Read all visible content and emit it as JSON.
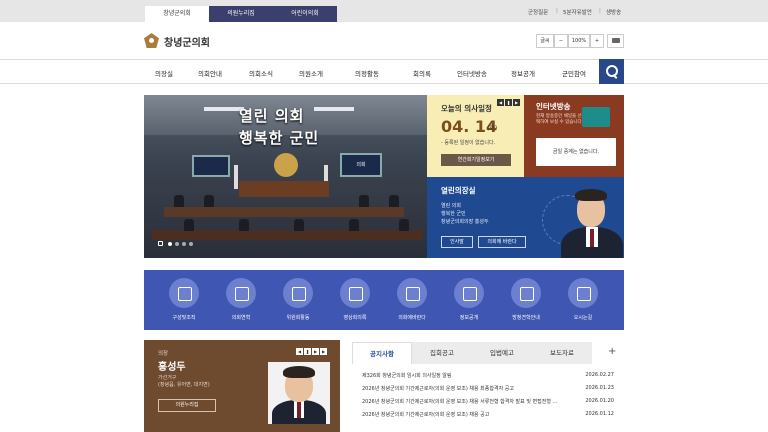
{
  "topbar": {
    "tabs": [
      "창녕군의회",
      "의원누리집",
      "어린이의회"
    ],
    "links": [
      "군정질문",
      "5분자유발언",
      "생방송"
    ]
  },
  "header": {
    "logo_text": "창녕군의회",
    "zoom": {
      "label": "글씨",
      "minus": "−",
      "value": "100%",
      "plus": "+"
    }
  },
  "nav": {
    "items": [
      "의장실",
      "의회안내",
      "의회소식",
      "의원소개",
      "의정활동",
      "회의록",
      "인터넷방송",
      "정보공개",
      "군민참여"
    ]
  },
  "hero": {
    "line1": "열린 의회",
    "line2": "행복한 군민",
    "screen_label": "의회"
  },
  "schedule": {
    "title": "오늘의 의사일정",
    "date": "04. 14",
    "day": "(화)",
    "note": "- 등록된 일정이 없습니다.",
    "button": "연간회기일정보기"
  },
  "broadcast": {
    "title": "인터넷방송",
    "desc": "현재 방송중인 채널을 선택하여 보실 수 있습니다.",
    "status": "금일 중계는 없습니다."
  },
  "chair": {
    "title": "열린의장실",
    "desc": [
      "열린 의회",
      "행복한 군민",
      "창녕군의회의장 홍성두"
    ],
    "buttons": [
      "인사말",
      "의회에 바란다"
    ]
  },
  "quick_menu": {
    "items": [
      "구성및조직",
      "의회연혁",
      "위원회활동",
      "영상회의록",
      "의회에바란다",
      "정보공개",
      "방청견학안내",
      "오시는길"
    ]
  },
  "speaker": {
    "role": "의장",
    "name": "홍성두",
    "district_title": "가선거구",
    "district_areas": "(창녕읍, 유어면, 대지면)",
    "button": "의원누리집"
  },
  "notice": {
    "tabs": [
      "공지사항",
      "입법예고",
      "입법예고",
      "보도자료"
    ],
    "plus": "+",
    "rows": [
      {
        "title": "제326회 창녕군의회 임시회 의사일정 알림",
        "date": "2026.02.27"
      },
      {
        "title": "2026년 창녕군의회 기간제근로자(의회 운영 보조) 채용 최종합격자 공고",
        "date": "2026.01.23"
      },
      {
        "title": "2026년 창녕군의회 기간제근로자(의회 운영 보조) 채용 서류전형 합격자 발표 및 면접전형 ...",
        "date": "2026.01.20"
      },
      {
        "title": "2026년 창녕군의회 기간제근로자(의회 운영 보조) 채용 공고",
        "date": "2026.01.12"
      }
    ]
  }
}
